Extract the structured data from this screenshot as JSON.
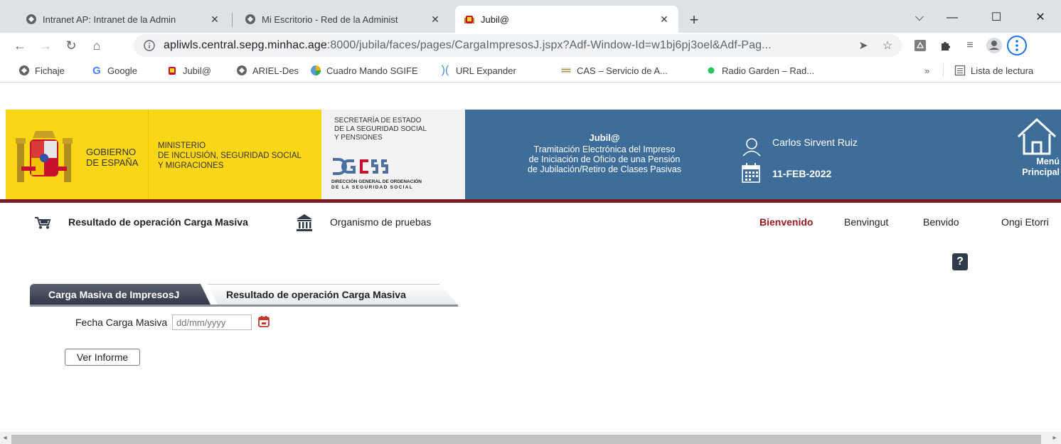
{
  "browser": {
    "tabs": [
      {
        "title": "Intranet AP: Intranet de la Admin",
        "icon": "globe-icon"
      },
      {
        "title": "Mi Escritorio - Red de la Administ",
        "icon": "globe-icon"
      },
      {
        "title": "Jubil@",
        "icon": "shield-crest-icon",
        "active": true
      }
    ],
    "new_tab_label": "+",
    "url_host": "apliwls.central.sepg.minhac.age",
    "url_rest": ":8000/jubila/faces/pages/CargaImpresosJ.jspx?Adf-Window-Id=w1bj6pj3oel&Adf-Pag...",
    "bookmarks": [
      {
        "label": "Fichaje",
        "icon": "globe-icon"
      },
      {
        "label": "Google",
        "icon": "google-icon"
      },
      {
        "label": "Jubil@",
        "icon": "shield-crest-icon"
      },
      {
        "label": "ARIEL-Des",
        "icon": "globe-icon"
      },
      {
        "label": "Cuadro Mando SGIFE",
        "icon": "chart-icon"
      },
      {
        "label": "URL Expander",
        "icon": "url-expander-icon"
      },
      {
        "label": "CAS – Servicio de A...",
        "icon": "cas-icon"
      },
      {
        "label": "Radio Garden – Rad...",
        "icon": "green-dot-icon"
      }
    ],
    "bookmarks_overflow": "»",
    "reading_list": "Lista de lectura"
  },
  "banner": {
    "gobierno_line1": "GOBIERNO",
    "gobierno_line2": "DE ESPAÑA",
    "ministerio_line1": "MINISTERIO",
    "ministerio_line2": "DE INCLUSIÓN, SEGURIDAD SOCIAL",
    "ministerio_line3": "Y MIGRACIONES",
    "secretaria_line1": "SECRETARÍA DE ESTADO",
    "secretaria_line2": "DE LA SEGURIDAD SOCIAL",
    "secretaria_line3": "Y PENSIONES",
    "dgcss_line1": "DIRECCIÓN GENERAL DE ORDENACIÓN",
    "dgcss_line2": "DE LA SEGURIDAD SOCIAL",
    "app_title": "Jubil@",
    "app_desc_line1": "Tramitación Electrónica del Impreso",
    "app_desc_line2": "de Iniciación de Oficio de una Pensión",
    "app_desc_line3": "de Jubilación/Retiro de Clases Pasivas",
    "user_name": "Carlos Sirvent Ruiz",
    "date": "11-FEB-2022",
    "menu_line1": "Menú",
    "menu_line2": "Principal",
    "colors": {
      "yellow": "#f9d616",
      "blue": "#3d6d98",
      "dark_red": "#7a1e26"
    }
  },
  "page": {
    "operation_title": "Resultado de operación Carga Masiva",
    "organismo": "Organismo de pruebas",
    "languages": [
      "Bienvenido",
      "Benvingut",
      "Benvido",
      "Ongi Etorri"
    ],
    "help_label": "?",
    "tabs": [
      {
        "label": "Carga Masiva de ImpresosJ",
        "active": true
      },
      {
        "label": "Resultado de operación Carga Masiva",
        "active": false
      }
    ],
    "form": {
      "fecha_label": "Fecha Carga Masiva",
      "fecha_placeholder": "dd/mm/yyyy",
      "ver_informe_label": "Ver Informe"
    }
  }
}
